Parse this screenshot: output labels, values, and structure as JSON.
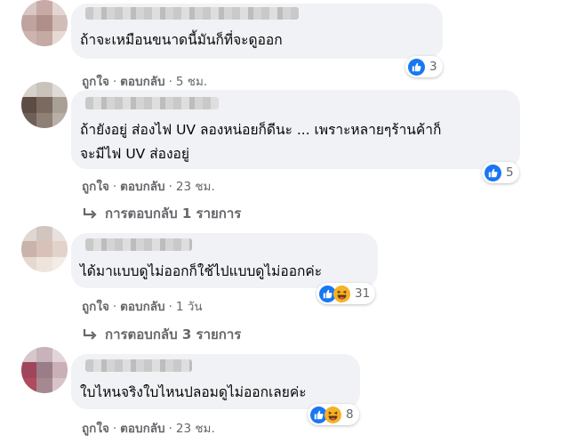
{
  "comments": [
    {
      "text": [
        "ถ้าจะเหมือนขนาดนี้มันก็ที่จะดูออก"
      ],
      "meta": {
        "like": "ถูกใจ",
        "reply": "ตอบกลับ",
        "time": "5 ชม."
      },
      "reaction_count": "3",
      "reactions": [
        "like-icon"
      ]
    },
    {
      "text": [
        "ถ้ายังอยู่ ส่องไฟ UV ลองหน่อยก็ดีนะ ... เพราะหลายๆร้านค้าก็",
        "จะมีไฟ UV ส่องอยู่"
      ],
      "meta": {
        "like": "ถูกใจ",
        "reply": "ตอบกลับ",
        "time": "23 ชม."
      },
      "reaction_count": "5",
      "reactions": [
        "like-icon"
      ],
      "replies_label": "การตอบกลับ 1 รายการ"
    },
    {
      "text": [
        "ได้มาแบบดูไม่ออกก็ใช้ไปแบบดูไม่ออกค่ะ"
      ],
      "meta": {
        "like": "ถูกใจ",
        "reply": "ตอบกลับ",
        "time": "1 วัน"
      },
      "reaction_count": "31",
      "reactions": [
        "like-icon",
        "haha-icon"
      ],
      "replies_label": "การตอบกลับ 3 รายการ"
    },
    {
      "text": [
        "ใบไหนจริงใบไหนปลอมดูไม่ออกเลยค่ะ"
      ],
      "meta": {
        "like": "ถูกใจ",
        "reply": "ตอบกลับ",
        "time": "23 ชม."
      },
      "reaction_count": "8",
      "reactions": [
        "like-icon",
        "haha-icon"
      ]
    }
  ],
  "colors": {
    "bubble": "#f0f2f5",
    "meta_text": "#65676b",
    "like_blue": "#1877f2",
    "haha_yellow": "#f7b125"
  }
}
